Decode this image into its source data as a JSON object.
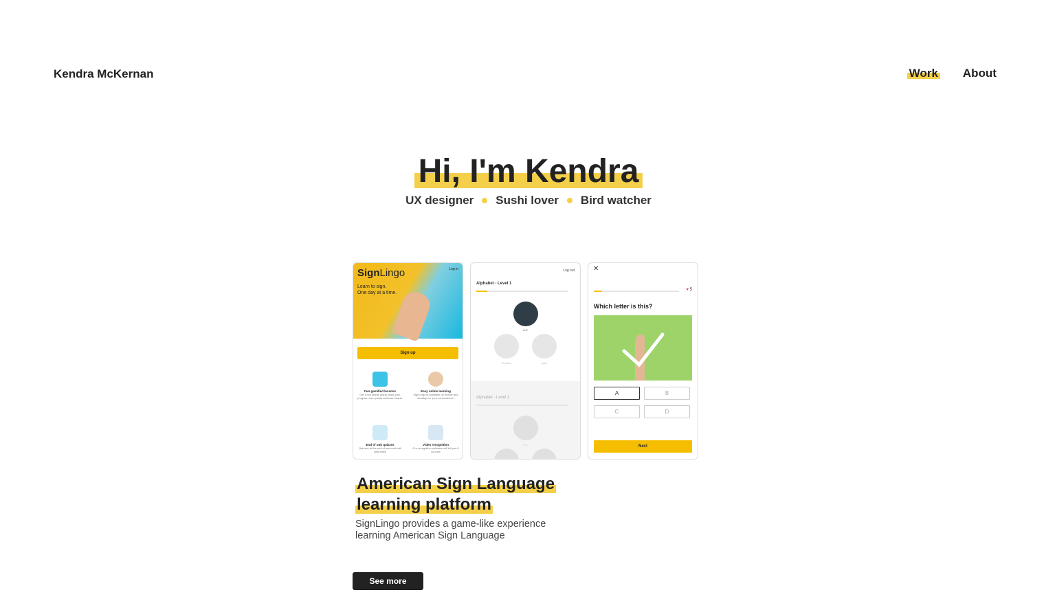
{
  "header": {
    "brand": "Kendra McKernan",
    "nav": [
      {
        "label": "Work",
        "active": true
      },
      {
        "label": "About",
        "active": false
      }
    ]
  },
  "hero": {
    "title": "Hi, I'm Kendra",
    "tags": [
      "UX designer",
      "Sushi lover",
      "Bird watcher"
    ]
  },
  "project": {
    "title": "American Sign Language learning platform",
    "description": "SignLingo provides a game-like experience learning American Sign Language",
    "button": "See more",
    "screens": {
      "screen1": {
        "logo_bold": "Sign",
        "logo_rest": "Lingo",
        "login": "Log in",
        "tagline1": "Learn to sign.",
        "tagline2": "One day at a time.",
        "signup": "Sign up",
        "features": [
          {
            "title": "Fun gamified lessons",
            "desc": "Get a hot streak going, track your progess, earn points and lose hearts."
          },
          {
            "title": "Easy online learning",
            "desc": "SignLingo is available on mobile and desktop for your convenience!"
          },
          {
            "title": "End of unit quizzes",
            "desc": "Quizzes at the end of each unit will help track"
          },
          {
            "title": "Video recognition",
            "desc": "Our recognition software will tell you if you are"
          }
        ]
      },
      "screen2": {
        "logout": "Log out",
        "level1": "Alphabet - Level 1",
        "level1_node": "A-E",
        "practice": "Practice",
        "quiz": "Quiz",
        "level2": "Alphabet - Level 2",
        "level2_node": "F-J"
      },
      "screen3": {
        "close": "✕",
        "hearts": "5",
        "question": "Which letter is this?",
        "options": [
          "A",
          "B",
          "C",
          "D"
        ],
        "selected": "A",
        "next": "Next"
      }
    }
  },
  "colors": {
    "accent": "#f4d04a",
    "button_yellow": "#f5be00",
    "dark": "#222222"
  }
}
